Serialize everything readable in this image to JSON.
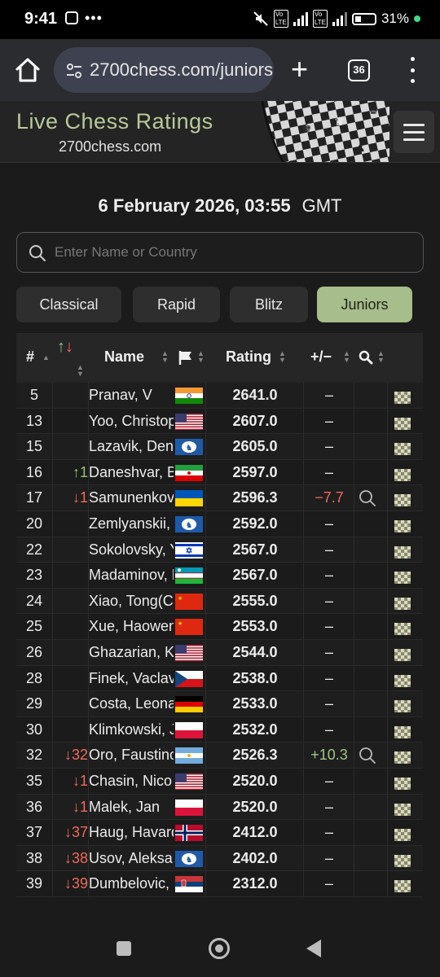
{
  "status_bar": {
    "time": "9:41",
    "battery": "31%"
  },
  "browser": {
    "url": "2700chess.com/juniors",
    "tab_count": "36"
  },
  "site": {
    "title": "Live Chess Ratings",
    "domain": "2700chess.com"
  },
  "datetime": {
    "date": "6 February 2026, 03:55",
    "tz": "GMT"
  },
  "search": {
    "placeholder": "Enter Name or Country"
  },
  "tabs": [
    {
      "label": "Classical",
      "active": false
    },
    {
      "label": "Rapid",
      "active": false
    },
    {
      "label": "Blitz",
      "active": false
    },
    {
      "label": "Juniors",
      "active": true
    }
  ],
  "table": {
    "headers": {
      "rank": "#",
      "name": "Name",
      "rating": "Rating",
      "diff": "+/−"
    },
    "rows": [
      {
        "rank": "5",
        "change": "",
        "dir": "",
        "name": "Pranav, V",
        "flag": "in",
        "rating": "2641.0",
        "diff": "–",
        "search": false
      },
      {
        "rank": "13",
        "change": "",
        "dir": "",
        "name": "Yoo, Christopher",
        "flag": "us",
        "rating": "2607.0",
        "diff": "–",
        "search": false
      },
      {
        "rank": "15",
        "change": "",
        "dir": "",
        "name": "Lazavik, Denis",
        "flag": "fide",
        "rating": "2605.0",
        "diff": "–",
        "search": false
      },
      {
        "rank": "16",
        "change": "↑1",
        "dir": "up",
        "name": "Daneshvar, Bardiya",
        "flag": "ir",
        "rating": "2597.0",
        "diff": "–",
        "search": false
      },
      {
        "rank": "17",
        "change": "↓1",
        "dir": "down",
        "name": "Samunenkov, Ilya",
        "flag": "ua",
        "rating": "2596.3",
        "diff": "−7.7",
        "search": true
      },
      {
        "rank": "20",
        "change": "",
        "dir": "",
        "name": "Zemlyanskii, Ivan",
        "flag": "fide",
        "rating": "2592.0",
        "diff": "–",
        "search": false
      },
      {
        "rank": "22",
        "change": "",
        "dir": "",
        "name": "Sokolovsky, Yahli",
        "flag": "il",
        "rating": "2567.0",
        "diff": "–",
        "search": false
      },
      {
        "rank": "23",
        "change": "",
        "dir": "",
        "name": "Madaminov, Mukhiddin",
        "flag": "uz",
        "rating": "2567.0",
        "diff": "–",
        "search": false
      },
      {
        "rank": "24",
        "change": "",
        "dir": "",
        "name": "Xiao, Tong(Chn)",
        "flag": "cn",
        "rating": "2555.0",
        "diff": "–",
        "search": false
      },
      {
        "rank": "25",
        "change": "",
        "dir": "",
        "name": "Xue, Haowen",
        "flag": "cn",
        "rating": "2553.0",
        "diff": "–",
        "search": false
      },
      {
        "rank": "26",
        "change": "",
        "dir": "",
        "name": "Ghazarian, Kirk",
        "flag": "us",
        "rating": "2544.0",
        "diff": "–",
        "search": false
      },
      {
        "rank": "28",
        "change": "",
        "dir": "",
        "name": "Finek, Vaclav",
        "flag": "cz",
        "rating": "2538.0",
        "diff": "–",
        "search": false
      },
      {
        "rank": "29",
        "change": "",
        "dir": "",
        "name": "Costa, Leonardo",
        "flag": "de",
        "rating": "2533.0",
        "diff": "–",
        "search": false
      },
      {
        "rank": "30",
        "change": "",
        "dir": "",
        "name": "Klimkowski, Jan",
        "flag": "pl",
        "rating": "2532.0",
        "diff": "–",
        "search": false
      },
      {
        "rank": "32",
        "change": "↓32",
        "dir": "down",
        "name": "Oro, Faustino",
        "flag": "ar",
        "rating": "2526.3",
        "diff": "+10.3",
        "search": true
      },
      {
        "rank": "35",
        "change": "↓1",
        "dir": "down",
        "name": "Chasin, Nico",
        "flag": "us",
        "rating": "2520.0",
        "diff": "–",
        "search": false
      },
      {
        "rank": "36",
        "change": "↓1",
        "dir": "down",
        "name": "Malek, Jan",
        "flag": "pl",
        "rating": "2520.0",
        "diff": "–",
        "search": false
      },
      {
        "rank": "37",
        "change": "↓37",
        "dir": "down",
        "name": "Haug, Havard",
        "flag": "no",
        "rating": "2412.0",
        "diff": "–",
        "search": false
      },
      {
        "rank": "38",
        "change": "↓38",
        "dir": "down",
        "name": "Usov, Aleksandr",
        "flag": "fide",
        "rating": "2402.0",
        "diff": "–",
        "search": false
      },
      {
        "rank": "39",
        "change": "↓39",
        "dir": "down",
        "name": "Dumbelovic, Luka",
        "flag": "rs",
        "rating": "2312.0",
        "diff": "–",
        "search": false
      }
    ]
  },
  "colors": {
    "accent": "#a7bd8c",
    "title": "#b8c99a",
    "up": "#8fc57b",
    "down": "#ef6a5a"
  }
}
